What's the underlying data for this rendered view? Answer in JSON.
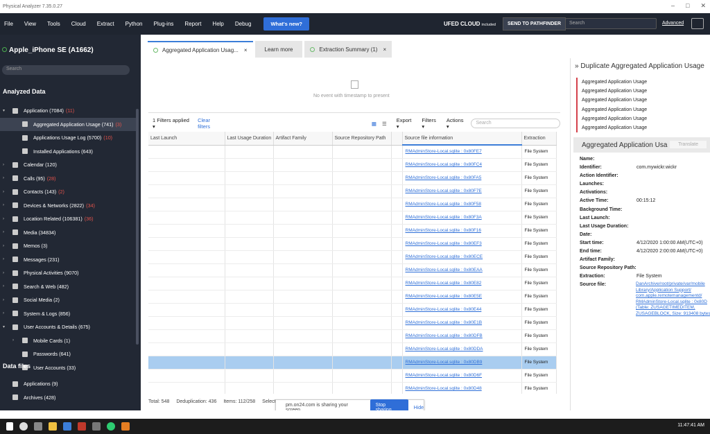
{
  "window": {
    "title": "Physical Analyzer 7.35.0.27",
    "controls": [
      "–",
      "□",
      "✕"
    ]
  },
  "menu": {
    "items": [
      "File",
      "View",
      "Tools",
      "Cloud",
      "Extract",
      "Python",
      "Plug-ins",
      "Report",
      "Help",
      "Debug"
    ],
    "whats_new": "What's new?",
    "ufed_cloud": "UFED CLOUD",
    "ufed_included": "included",
    "send_pathfinder": "SEND TO PATHFINDER",
    "search_placeholder": "Search",
    "advanced": "Advanced"
  },
  "sidebar": {
    "device": "Apple_iPhone SE (A1662)",
    "search_placeholder": "Search",
    "analyzed_header": "Analyzed Data",
    "data_files_header": "Data files",
    "tree": [
      {
        "label": "Application (7084)",
        "badge": "(11)",
        "level": 0,
        "chevron": "▾"
      },
      {
        "label": "Aggregated Application Usage (741)",
        "badge": "(3)",
        "level": 1,
        "chevron": "",
        "selected": true
      },
      {
        "label": "Applications Usage Log (5700)",
        "badge": "(10)",
        "level": 1,
        "chevron": ""
      },
      {
        "label": "Installed Applications (643)",
        "badge": "",
        "level": 1,
        "chevron": ""
      },
      {
        "label": "Calendar (120)",
        "badge": "",
        "level": 0,
        "chevron": "›"
      },
      {
        "label": "Calls (95)",
        "badge": "(28)",
        "level": 0,
        "chevron": "›"
      },
      {
        "label": "Contacts (143)",
        "badge": "(2)",
        "level": 0,
        "chevron": "›"
      },
      {
        "label": "Devices & Networks (2822)",
        "badge": "(34)",
        "level": 0,
        "chevron": "›"
      },
      {
        "label": "Location Related (106381)",
        "badge": "(36)",
        "level": 0,
        "chevron": "›"
      },
      {
        "label": "Media (34834)",
        "badge": "",
        "level": 0,
        "chevron": "›"
      },
      {
        "label": "Memos (3)",
        "badge": "",
        "level": 0,
        "chevron": "›"
      },
      {
        "label": "Messages (231)",
        "badge": "",
        "level": 0,
        "chevron": "›"
      },
      {
        "label": "Physical Activities (9070)",
        "badge": "",
        "level": 0,
        "chevron": "›"
      },
      {
        "label": "Search & Web (482)",
        "badge": "",
        "level": 0,
        "chevron": "›"
      },
      {
        "label": "Social Media (2)",
        "badge": "",
        "level": 0,
        "chevron": "›"
      },
      {
        "label": "System & Logs (856)",
        "badge": "",
        "level": 0,
        "chevron": "›"
      },
      {
        "label": "User Accounts & Details (675)",
        "badge": "",
        "level": 0,
        "chevron": "▾"
      },
      {
        "label": "Mobile Cards (1)",
        "badge": "",
        "level": 1,
        "chevron": "›"
      },
      {
        "label": "Passwords (641)",
        "badge": "",
        "level": 1,
        "chevron": ""
      },
      {
        "label": "User Accounts (33)",
        "badge": "",
        "level": 1,
        "chevron": ""
      }
    ],
    "data_files": [
      {
        "label": "Applications (9)"
      },
      {
        "label": "Archives (428)"
      }
    ]
  },
  "tabs": [
    {
      "label": "Aggregated Application Usag...",
      "close": "×",
      "active": true
    },
    {
      "label": "Learn more",
      "close": "",
      "active": false
    },
    {
      "label": "Extraction Summary (1)",
      "close": "×",
      "active": false
    }
  ],
  "timeline": {
    "message": "No event with timestamp to present"
  },
  "toolbar": {
    "filters_applied": "1 Filters applied ▾",
    "clear_filters": "Clear filters",
    "export": "Export ▾",
    "filters": "Filters ▾",
    "actions": "Actions ▾",
    "search_placeholder": "Search"
  },
  "table": {
    "columns": [
      "Last Launch",
      "Last Usage Duration",
      "Artifact Family",
      "Source Repository Path",
      "",
      "Source file information",
      "Extraction"
    ],
    "rows": [
      {
        "source": "RMAdminStore-Local.sqlite : 0x80FE7",
        "extraction": "File System"
      },
      {
        "source": "RMAdminStore-Local.sqlite : 0x80FC4",
        "extraction": "File System"
      },
      {
        "source": "RMAdminStore-Local.sqlite : 0x80FA5",
        "extraction": "File System"
      },
      {
        "source": "RMAdminStore-Local.sqlite : 0x80F7E",
        "extraction": "File System"
      },
      {
        "source": "RMAdminStore-Local.sqlite : 0x80F58",
        "extraction": "File System"
      },
      {
        "source": "RMAdminStore-Local.sqlite : 0x80F3A",
        "extraction": "File System"
      },
      {
        "source": "RMAdminStore-Local.sqlite : 0x80F16",
        "extraction": "File System"
      },
      {
        "source": "RMAdminStore-Local.sqlite : 0x80EF3",
        "extraction": "File System"
      },
      {
        "source": "RMAdminStore-Local.sqlite : 0x80ECE",
        "extraction": "File System"
      },
      {
        "source": "RMAdminStore-Local.sqlite : 0x80EAA",
        "extraction": "File System"
      },
      {
        "source": "RMAdminStore-Local.sqlite : 0x80E82",
        "extraction": "File System"
      },
      {
        "source": "RMAdminStore-Local.sqlite : 0x80E5E",
        "extraction": "File System"
      },
      {
        "source": "RMAdminStore-Local.sqlite : 0x80E44",
        "extraction": "File System"
      },
      {
        "source": "RMAdminStore-Local.sqlite : 0x80E1B",
        "extraction": "File System"
      },
      {
        "source": "RMAdminStore-Local.sqlite : 0x80DFB",
        "extraction": "File System"
      },
      {
        "source": "RMAdminStore-Local.sqlite : 0x80DDA",
        "extraction": "File System"
      },
      {
        "source": "RMAdminStore-Local.sqlite : 0x80DB9",
        "extraction": "File System",
        "highlight": true
      },
      {
        "source": "RMAdminStore-Local.sqlite : 0x80D6F",
        "extraction": "File System"
      },
      {
        "source": "RMAdminStore-Local.sqlite : 0x80D48",
        "extraction": "File System"
      }
    ]
  },
  "status": {
    "total": "Total: 548",
    "dedup": "Deduplication: 436",
    "items": "Items: 112/258",
    "selected": "Selecte"
  },
  "share": {
    "message": "pm.on24.com is sharing your screen.",
    "stop": "Stop sharing",
    "hide": "Hide"
  },
  "right": {
    "title": "Duplicate Aggregated Application Usage",
    "duplicates": [
      "Aggregated Application Usage",
      "Aggregated Application Usage",
      "Aggregated Application Usage",
      "Aggregated Application Usage",
      "Aggregated Application Usage",
      "Aggregated Application Usage"
    ],
    "detail_title": "Aggregated Application Usa",
    "translate": "Translate",
    "fields": [
      {
        "k": "Name:",
        "v": ""
      },
      {
        "k": "Identifier:",
        "v": "com.mywickr.wickr"
      },
      {
        "k": "Action Identifier:",
        "v": ""
      },
      {
        "k": "Launches:",
        "v": ""
      },
      {
        "k": "Activations:",
        "v": ""
      },
      {
        "k": "Active Time:",
        "v": "00:15:12"
      },
      {
        "k": "Background Time:",
        "v": ""
      },
      {
        "k": "Last Launch:",
        "v": ""
      },
      {
        "k": "Last Usage Duration:",
        "v": ""
      },
      {
        "k": "Date:",
        "v": ""
      },
      {
        "k": "Start time:",
        "v": "4/12/2020 1:00:00 AM(UTC+0)"
      },
      {
        "k": "End time:",
        "v": "4/12/2020 2:00:00 AM(UTC+0)"
      },
      {
        "k": "Artifact Family:",
        "v": ""
      },
      {
        "k": "Source Repository Path:",
        "v": ""
      },
      {
        "k": "Extraction:",
        "v": "File System"
      },
      {
        "k": "Source file:",
        "v": ""
      }
    ],
    "source_file_lines": [
      "DanArchive/root/private/var/mobile",
      "Library/Application Support/",
      "com.apple.remotemanagementd/",
      "RMAdminStore-Local.sqlite : 0x80D",
      "(Table: ZUSAGETIMEDITEM,",
      "ZUSAGEBLOCK, Size: 913408 bytes)"
    ]
  },
  "taskbar": {
    "clock": "11:47:41 AM"
  }
}
